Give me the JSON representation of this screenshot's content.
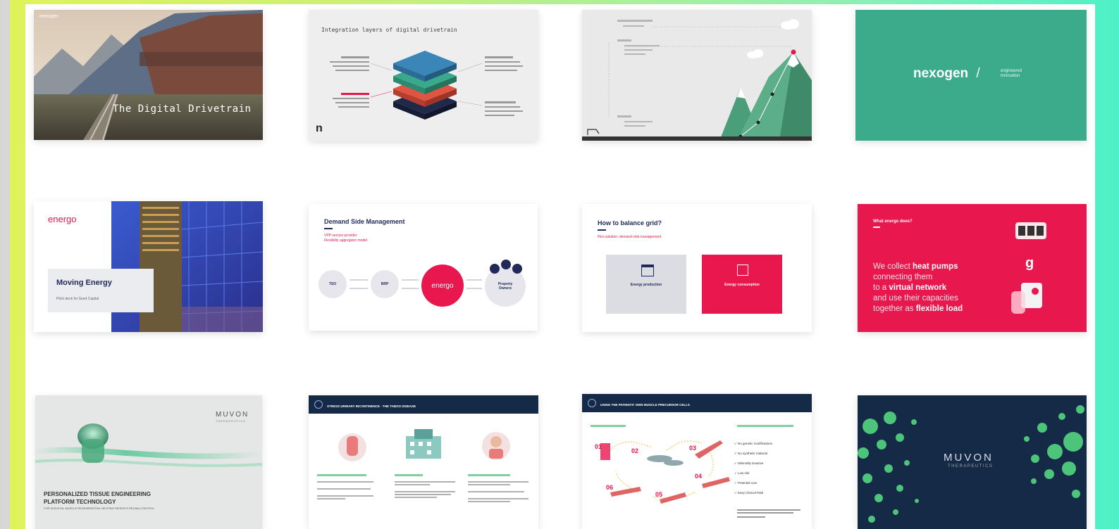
{
  "slides": {
    "s1": {
      "title": "The Digital Drivetrain",
      "brand": "nexogen"
    },
    "s2": {
      "title": "Integration layers of digital drivetrain",
      "logo": "n"
    },
    "s4": {
      "brand": "nexogen",
      "separator": "/",
      "tagline": "engineered innovation"
    },
    "s5": {
      "brand": "energo",
      "title": "Moving Energy",
      "subtitle": "Pitch deck for Seed Capital"
    },
    "s6": {
      "title": "Demand Side Management",
      "line1": "VPP service provider",
      "line2": "Flexibility aggregator model",
      "c1": "TSO",
      "c2": "BRP",
      "c3": "energo",
      "c4": "Property Owners"
    },
    "s7": {
      "title": "How to balance grid?",
      "subtitle": "Flex solution: demand side management",
      "box1": "Energy production",
      "box2": "Energy consumption"
    },
    "s8": {
      "eyebrow": "What energo does?",
      "t1": "We collect ",
      "t2": "heat pumps",
      "t3": "connecting them",
      "t4": "to a ",
      "t5": "virtual network",
      "t6": "and use their capacities",
      "t7": "together as ",
      "t8": "flexible load"
    },
    "s9": {
      "brand": "MUVON",
      "brand_sub": "THERAPEUTICS",
      "title1": "PERSONALIZED TISSUE ENGINEERING",
      "title2": "PLATFORM TECHNOLOGY",
      "subtitle": "FOR SKELETAL MUSCLE REGENERATION: HELPING PATIENTS REGAIN CONTROL"
    },
    "s10": {
      "title": "STRESS URINARY INCONTINENCE - THE TABOO DISEASE"
    },
    "s11": {
      "title": "USING THE PATIENTS' OWN MUSCLE PRECURSOR CELLS",
      "steps": [
        "01",
        "02",
        "03",
        "04",
        "05",
        "06"
      ],
      "checks": [
        "No genetic modifications",
        "No synthetic material",
        "Minimally invasive",
        "Low risk",
        "Potential cure",
        "Easy Clinical Path"
      ]
    },
    "s12": {
      "brand": "MUVON",
      "brand_sub": "THERAPEUTICS"
    }
  },
  "colors": {
    "nexogen_teal": "#3bab8c",
    "energo_pink": "#e8174d",
    "energo_navy": "#1f2a5a",
    "muvon_navy": "#152a46",
    "muvon_green": "#4cc47a"
  }
}
